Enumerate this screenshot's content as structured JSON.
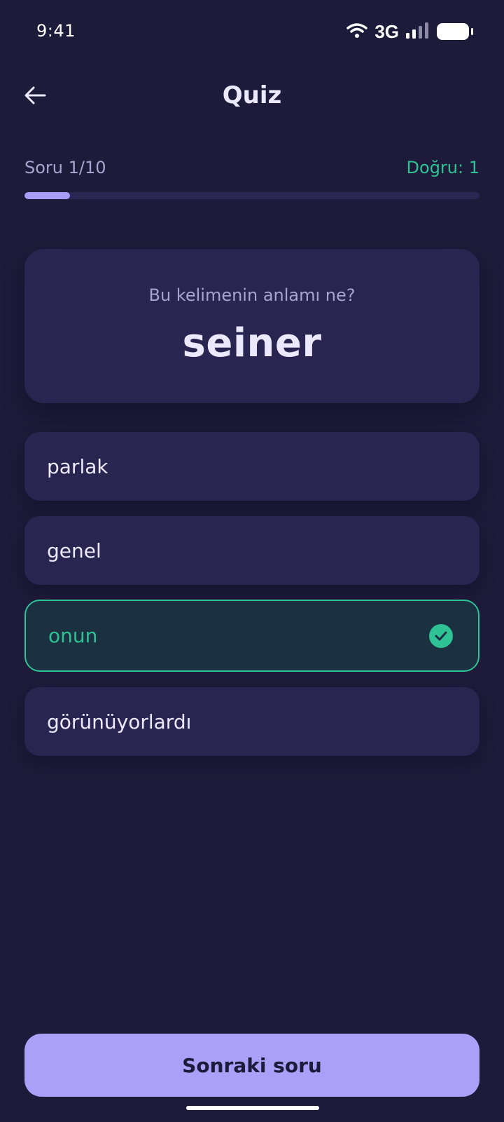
{
  "status_bar": {
    "time": "9:41",
    "network": "3G",
    "icons": [
      "wifi-icon",
      "signal-icon",
      "battery-icon"
    ]
  },
  "header": {
    "title": "Quiz",
    "back_icon": "arrow-left-icon"
  },
  "progress": {
    "label": "Soru 1/10",
    "correct_label": "Doğru: 1",
    "fraction": 0.1
  },
  "question": {
    "prompt": "Bu kelimenin anlamı ne?",
    "word": "seiner"
  },
  "options": [
    {
      "label": "parlak",
      "state": "default"
    },
    {
      "label": "genel",
      "state": "default"
    },
    {
      "label": "onun",
      "state": "correct",
      "icon": "check-circle-icon"
    },
    {
      "label": "görünüyorlardı",
      "state": "default"
    }
  ],
  "footer": {
    "next_label": "Sonraki soru"
  },
  "colors": {
    "background": "#1e1b3a",
    "card": "#2a2550",
    "accent": "#ab9ff8",
    "correct": "#2ec295",
    "text_primary": "#ece8ff",
    "text_secondary": "#a9a3cf"
  }
}
